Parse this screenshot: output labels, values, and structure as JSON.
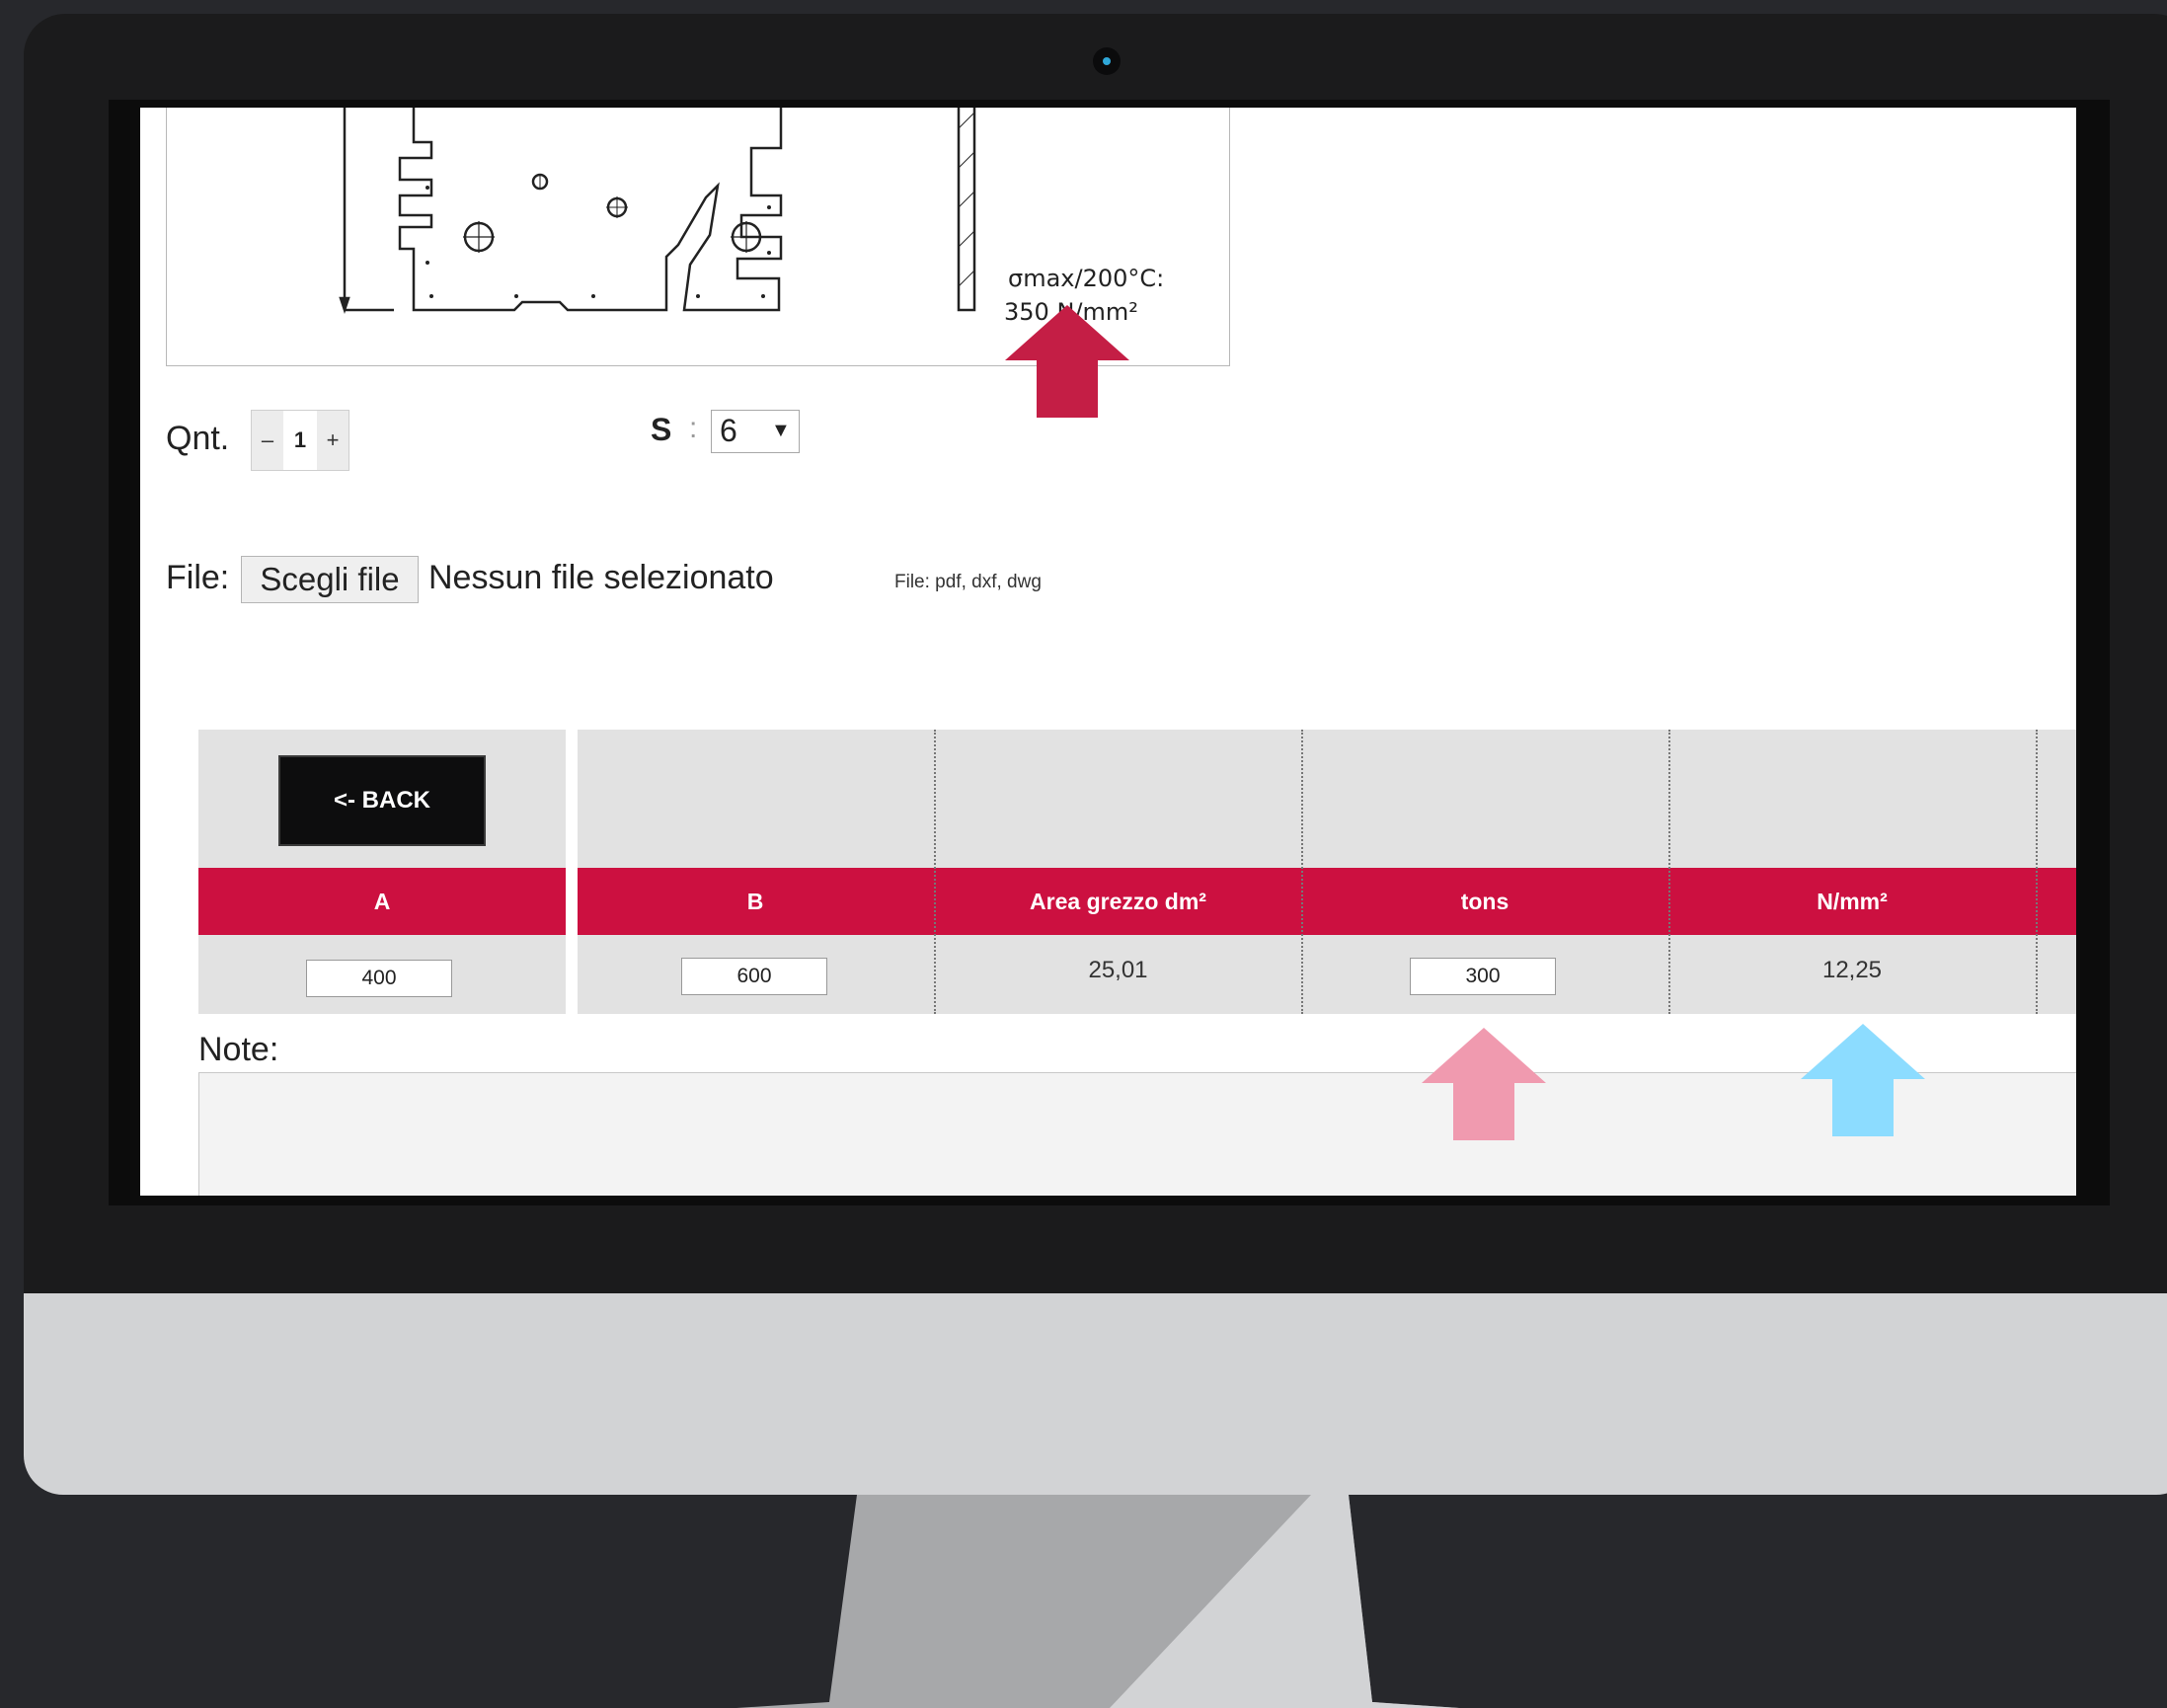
{
  "drawing": {
    "stress_label": "σmax/200°C:",
    "stress_value": "350 N/mm²"
  },
  "quantity": {
    "label": "Qnt.",
    "minus": "–",
    "value": "1",
    "plus": "+"
  },
  "s_select": {
    "label": "S",
    "colon": ":",
    "selected": "6",
    "arrow": "▼"
  },
  "file": {
    "label": "File:",
    "button": "Scegli file",
    "status": "Nessun file selezionato",
    "types": "File: pdf, dxf, dwg"
  },
  "table": {
    "back_button": "<- BACK",
    "headers": [
      "A",
      "B",
      "Area grezzo dm²",
      "tons",
      "N/mm²"
    ],
    "row": {
      "a": "400",
      "b": "600",
      "area": "25,01",
      "tons": "300",
      "nmm2": "12,25"
    }
  },
  "note": {
    "label": "Note:"
  },
  "colors": {
    "accent_red": "#cc1040",
    "arrow_red": "#c41e45",
    "arrow_pink": "#f09aaf",
    "arrow_blue": "#8cdcff"
  },
  "icons": [
    "webcam-icon",
    "dropdown-arrow-icon",
    "up-arrow-red-icon",
    "up-arrow-pink-icon",
    "up-arrow-blue-icon"
  ]
}
